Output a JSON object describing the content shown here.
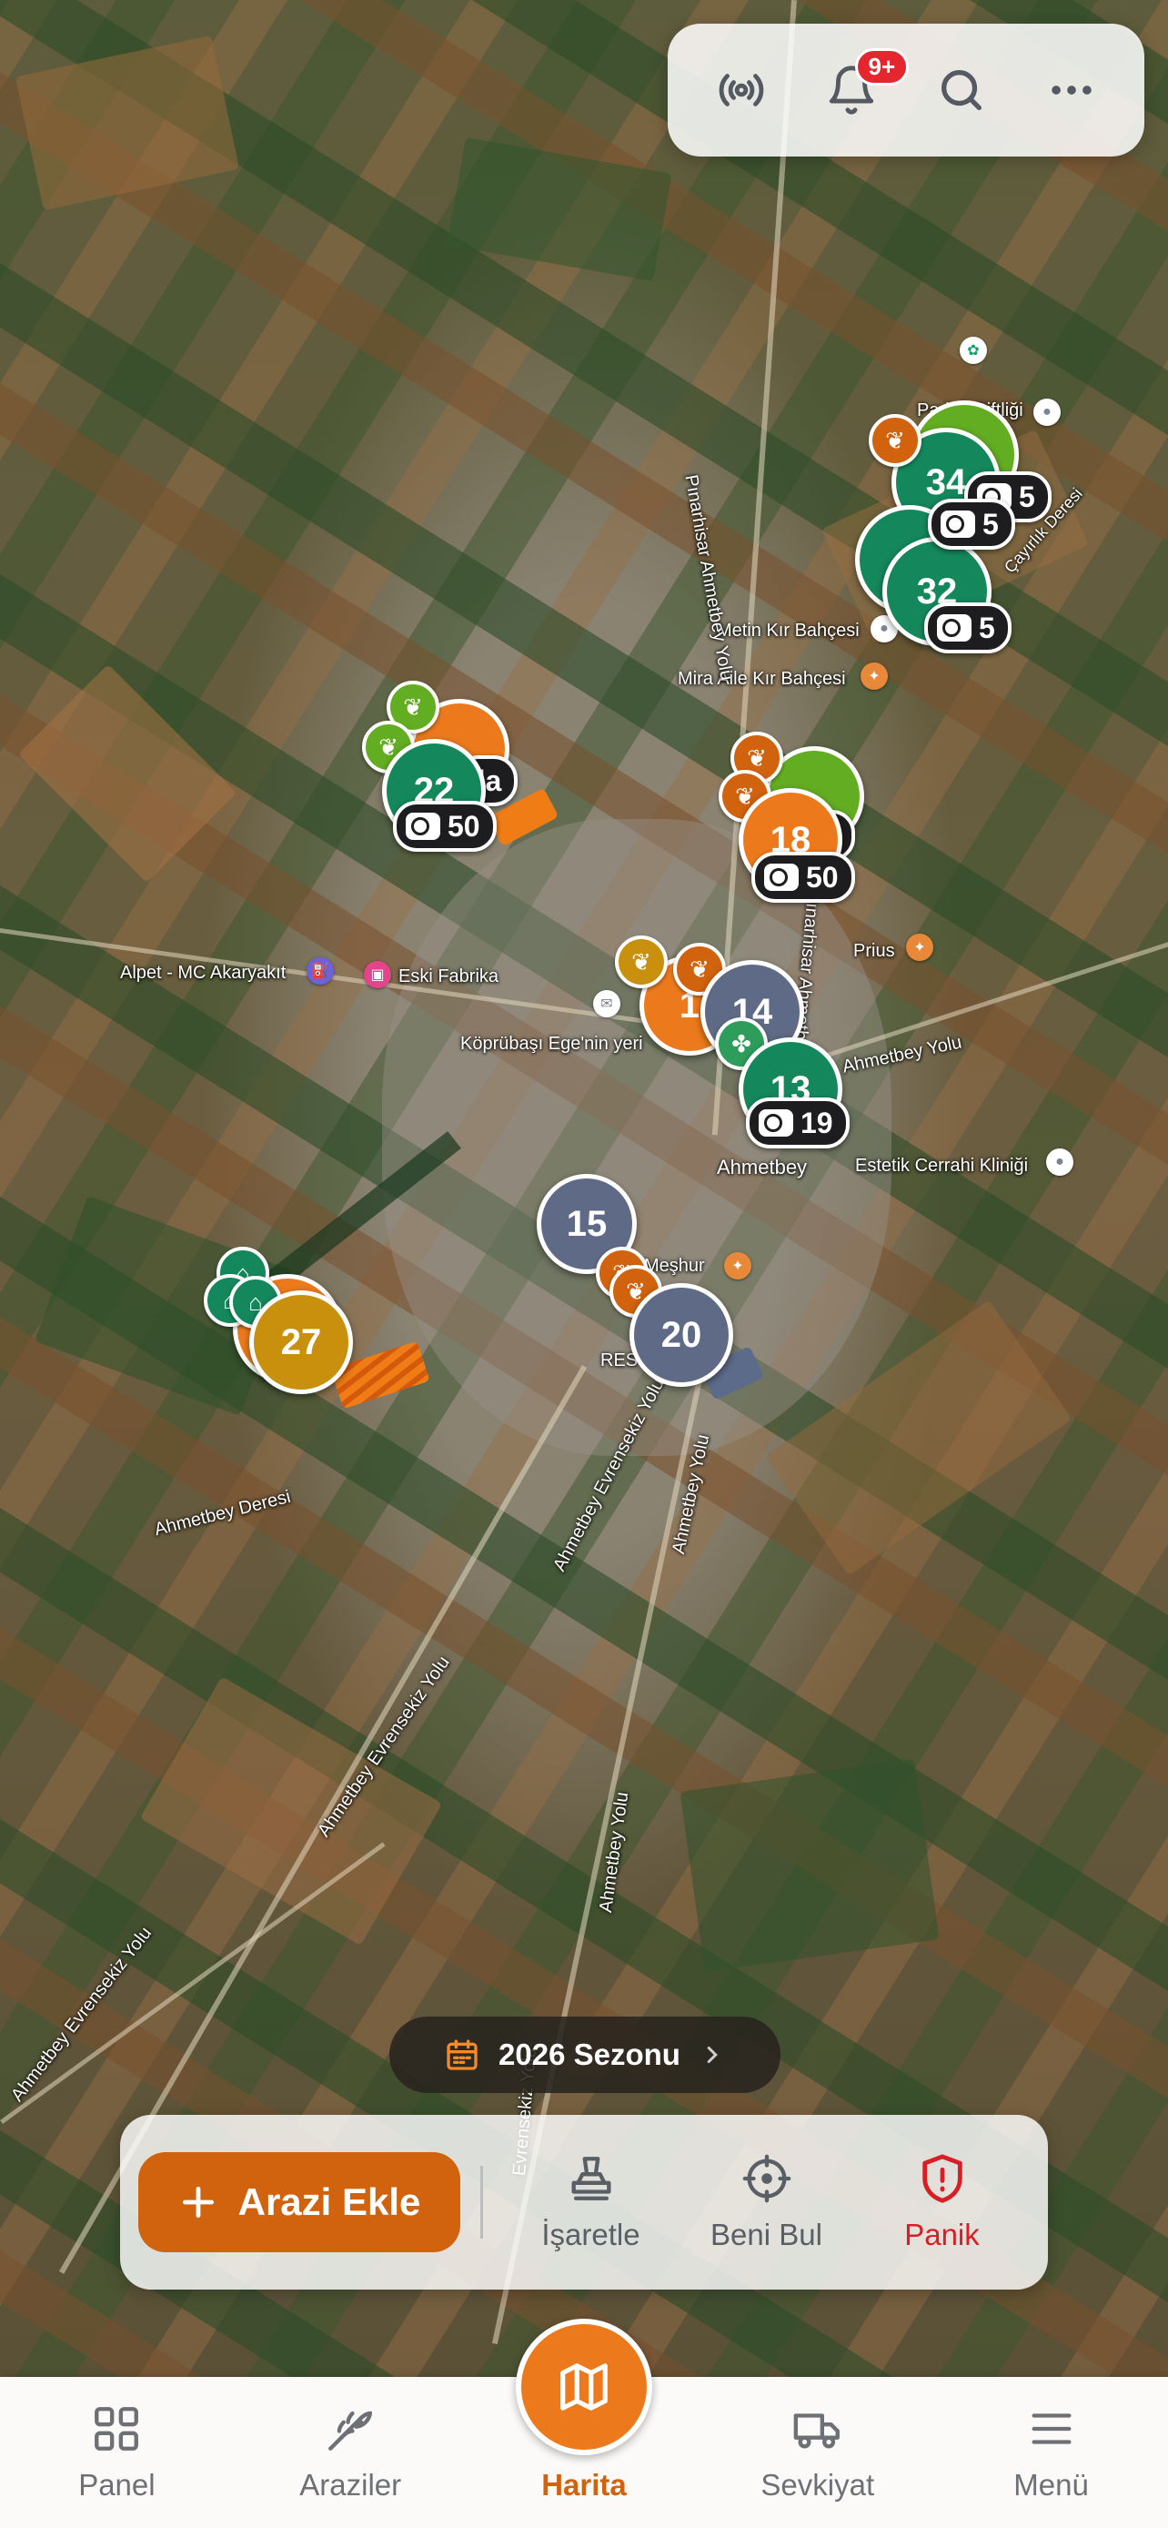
{
  "topbar": {
    "notification_badge": "9+",
    "icons": [
      "broadcast-icon",
      "bell-icon",
      "search-icon",
      "more-icon"
    ]
  },
  "map": {
    "labels": {
      "parlak_ciftligi": "Parlak Çiftliği",
      "metin_kir": "Metin Kır Bahçesi",
      "mira_aile": "Mira Aile Kır Bahçesi",
      "pinarhisar": "Pınarhisar Ahmetbey Yolu",
      "pinarhisar2": "Pınarhisar Ahmetbey Yolu",
      "prius": "Prius",
      "alpet": "Alpet - MC Akaryakıt",
      "eski_fabrika": "Eski Fabrika",
      "koprubasi": "Köprübaşı Ege'nin yeri",
      "ahmetbey": "Ahmetbey",
      "ahmetbey_yolu": "Ahmetbey Yolu",
      "estetik": "Estetik Cerrahi Kliniği",
      "meshur": "Meşhur",
      "restaura": "RESTAURA",
      "ahmetbey_deresi": "Ahmetbey Deresi",
      "evrensekiz1": "Ahmetbey Evrensekiz Yolu",
      "evrensekiz2": "Ahmetbey Evrensekiz Yolu",
      "evrensekiz3": "Ahmetbey Evrensekiz Yolu",
      "ahmetbey_yolu2": "Ahmetbey Yolu",
      "ahmetbey_yolu3": "Ahmetbey Yolu",
      "evrensekiz_yolu": "Evrensekiz Yolu",
      "cayirlik_deresi": "Çayırlık Deresi"
    },
    "pins": {
      "p34": "34",
      "p32": "32",
      "p22": "22",
      "p18": "18",
      "p14": "14",
      "p13": "13",
      "p15": "15",
      "p20": "20",
      "p27": "27",
      "p1": "1"
    },
    "counts": {
      "c5a": "5",
      "c5b": "5",
      "c5c": "5",
      "c50a": "50",
      "c50b": "50",
      "c19": "19",
      "c0": "0",
      "cda": "da"
    }
  },
  "season": {
    "label": "2026 Sezonu"
  },
  "actions": {
    "add_land": "Arazi Ekle",
    "mark": "İşaretle",
    "locate": "Beni Bul",
    "panic": "Panik"
  },
  "tabs": {
    "panel": "Panel",
    "lands": "Araziler",
    "map": "Harita",
    "shipment": "Sevkiyat",
    "menu": "Menü"
  },
  "colors": {
    "accent": "#D1620E",
    "orange_pin": "#EC7A1C",
    "green_pin": "#15875C",
    "light_green_pin": "#63AD22",
    "slate_pin": "#5E6A86",
    "gold_pin": "#C9900E",
    "panic_red": "#D91F26"
  }
}
